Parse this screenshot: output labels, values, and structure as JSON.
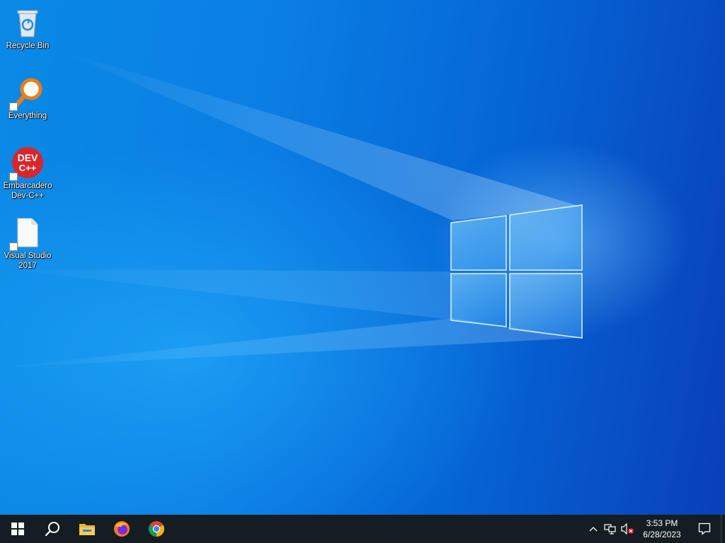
{
  "desktop": {
    "icons": [
      {
        "label": "Recycle Bin",
        "icon": "recycle-bin-icon"
      },
      {
        "label": "Everything",
        "icon": "everything-search-icon"
      },
      {
        "label": "Embarcadero Dev-C++",
        "icon": "devcpp-icon",
        "icon_text_1": "DEV",
        "icon_text_2": "C++"
      },
      {
        "label": "Visual Studio 2017",
        "icon": "blank-file-icon"
      }
    ],
    "wallpaper": {
      "colors": [
        "#0a8ae6",
        "#0566d6",
        "#0a3fb8"
      ],
      "logo": "windows-logo"
    }
  },
  "taskbar": {
    "background": "#141d22",
    "items": [
      {
        "name": "start",
        "icon": "windows-start-icon"
      },
      {
        "name": "search",
        "icon": "search-icon"
      },
      {
        "name": "file-explorer",
        "icon": "folder-icon"
      },
      {
        "name": "firefox",
        "icon": "firefox-icon"
      },
      {
        "name": "chrome",
        "icon": "chrome-icon"
      }
    ],
    "tray": {
      "icons": [
        "chevron-up-icon",
        "network-icon",
        "volume-muted-icon"
      ],
      "time": "3:53 PM",
      "date": "6/28/2023",
      "notification_icon": "action-center-icon"
    }
  }
}
